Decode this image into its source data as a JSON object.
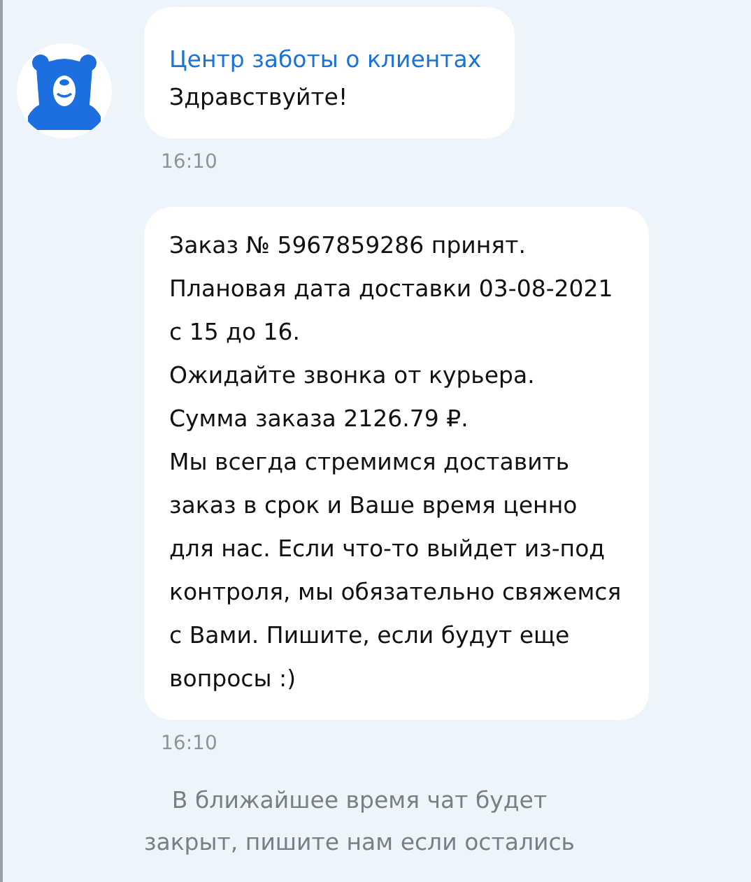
{
  "messages": [
    {
      "sender": "Центр заботы о клиентах",
      "lines": [
        "Здравствуйте!"
      ],
      "time": "16:10"
    },
    {
      "lines": [
        "Заказ № 5967859286 принят.",
        "Плановая дата доставки 03-08-2021",
        "с 15 до 16.",
        "Ожидайте звонка от курьера.",
        "Сумма заказа 2126.79 ₽.",
        "Мы всегда стремимся доставить",
        "заказ в срок и Ваше время ценно",
        "для нас. Если что-то выйдет из-под",
        "контроля, мы обязательно свяжемся",
        "с Вами. Пишите, если будут еще",
        "вопросы :)"
      ],
      "time": "16:10"
    }
  ],
  "notice": {
    "lines": [
      "В ближайшее время чат будет",
      "закрыт, пишите нам если остались"
    ]
  }
}
